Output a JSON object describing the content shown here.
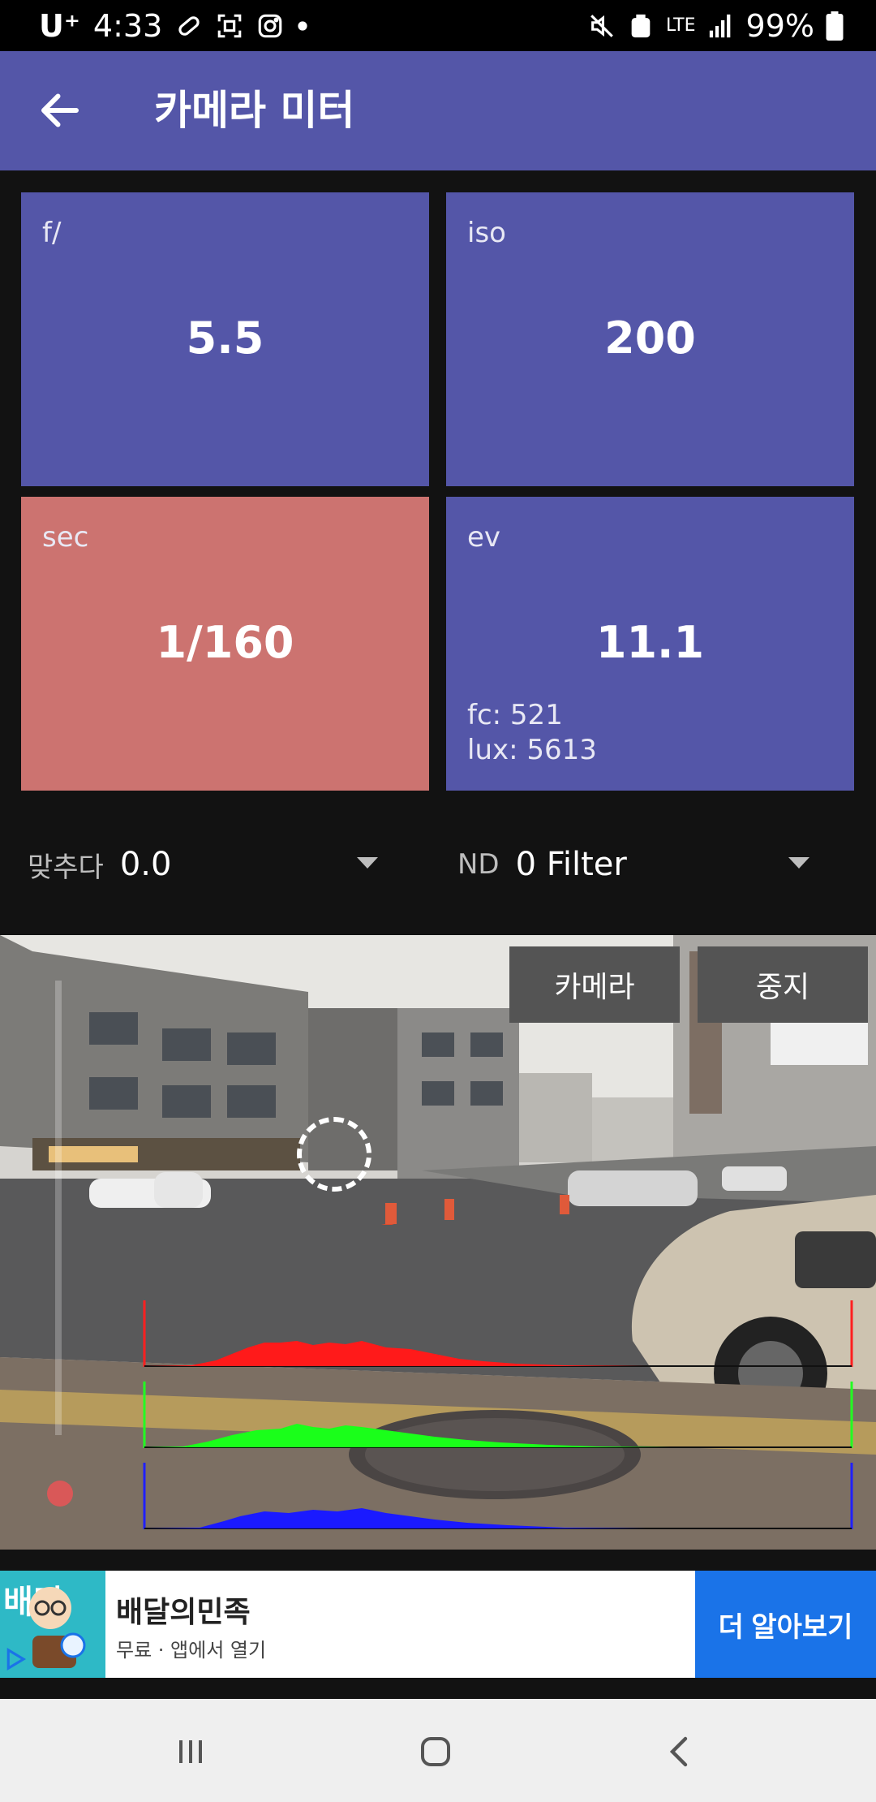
{
  "status_bar": {
    "carrier": "U⁺",
    "time": "4:33",
    "network": "LTE",
    "battery": "99%"
  },
  "app_bar": {
    "title": "카메라 미터"
  },
  "cards": {
    "aperture": {
      "label": "f/",
      "value": "5.5"
    },
    "iso": {
      "label": "iso",
      "value": "200"
    },
    "shutter": {
      "label": "sec",
      "value": "1/160"
    },
    "ev": {
      "label": "ev",
      "value": "11.1",
      "fc": "fc: 521",
      "lux": "lux: 5613"
    }
  },
  "controls": {
    "compensation": {
      "label": "맞추다",
      "value": "0.0"
    },
    "nd": {
      "label": "ND",
      "value": "0 Filter"
    }
  },
  "camera": {
    "camera_button": "카메라",
    "stop_button": "중지"
  },
  "ad": {
    "thumb_text": "배민",
    "title": "배달의민족",
    "subtitle": "무료 · 앱에서 열기",
    "cta": "더 알아보기"
  },
  "colors": {
    "app_bar": "#5456a8",
    "card_blue": "#5456a8",
    "card_red": "#cc7370",
    "ad_cta": "#1a73e8"
  }
}
